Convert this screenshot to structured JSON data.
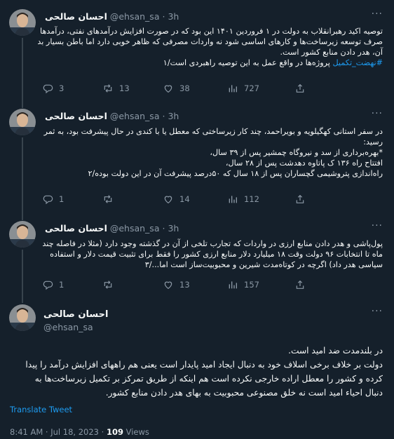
{
  "colors": {
    "background": "#15202b",
    "text": "#f7f9f9",
    "muted": "#8b98a5",
    "accent": "#1d9bf0",
    "border": "#38444d"
  },
  "author": {
    "name": "احسان صالحی",
    "handle": "@ehsan_sa"
  },
  "tweets": [
    {
      "name": "احسان صالحی",
      "handle": "@ehsan_sa",
      "time": "3h",
      "sep": "·",
      "lines": [
        "توصیه اکید رهبرانقلاب به دولت در ۱ فروردین ۱۴۰۱ این بود که در صورت افزایش درآمدهای نفتی، درآمدها",
        "صرف توسعه زیرساخت‌ها و کارهای اساسی شود نه واردات مصرفی که ظاهر خوبی دارد اما باطن بسیار بد",
        "آن، هدر دادن منابع کشور است."
      ],
      "hashtag": "#نهضت_تکمیل",
      "last_line_rest": "پروژه‌ها در واقع عمل به این توصیه راهبردی است/۱",
      "replies": "3",
      "retweets": "13",
      "likes": "38",
      "views": "727"
    },
    {
      "name": "احسان صالحی",
      "handle": "@ehsan_sa",
      "time": "3h",
      "sep": "·",
      "lines": [
        "در سفر استانی کهگیلویه و بویراحمد، چند کار زیرساختی که معطل یا با کندی در حال پیشرفت بود، به ثمر",
        "رسید:",
        "*بهره‌برداری از سد و نیروگاه چمشیر پس از ۳۹ سال،",
        "افتتاح راه ۱۳۶ ک پاتاوه دهدشت پس از ۲۸ سال،",
        "راه‌اندازی پتروشیمی گچساران پس از ۱۸ سال که ۵۰درصد پیشرفت آن در این دولت بوده/۲"
      ],
      "replies": "1",
      "retweets": "",
      "likes": "14",
      "views": "112"
    },
    {
      "name": "احسان صالحی",
      "handle": "@ehsan_sa",
      "time": "3h",
      "sep": "·",
      "lines": [
        "پول‌پاشی و هدر دادن منابع ارزی در واردات که تجارب تلخی از آن در گذشته وجود دارد (مثلا در فاصله چند",
        "ماه تا انتخابات ۹۶ دولت وقت ۱۸ میلیارد دلار منابع ارزی کشور را فقط برای تثبیت قیمت دلار و استفاده",
        "سیاسی هدر داد) اگرچه در کوتاه‌مدت شیرین و محبوبیت‌ساز است اما.../۳"
      ],
      "replies": "1",
      "retweets": "",
      "likes": "13",
      "views": "157"
    }
  ],
  "focus": {
    "name": "احسان صالحی",
    "handle": "@ehsan_sa",
    "lines": [
      "در بلندمدت ضد امید است.",
      "دولت بر خلاف برخی اسلاف خود به دنبال ایجاد امید پایدار است یعنی هم راههای افزایش درآمد را پیدا",
      "کرده و کشور را معطل اراده خارجی نکرده است هم اینکه از طریق تمرکز بر تکمیل زیرساخت‌ها به",
      "دنبال احیاء امید است نه خلق مصنوعی محبوبیت به بهای هدر دادن منابع کشور."
    ],
    "translate": "Translate Tweet",
    "time": "8:41 AM · Jul 18, 2023 · ",
    "views_count": "109",
    "views_label": " Views"
  }
}
